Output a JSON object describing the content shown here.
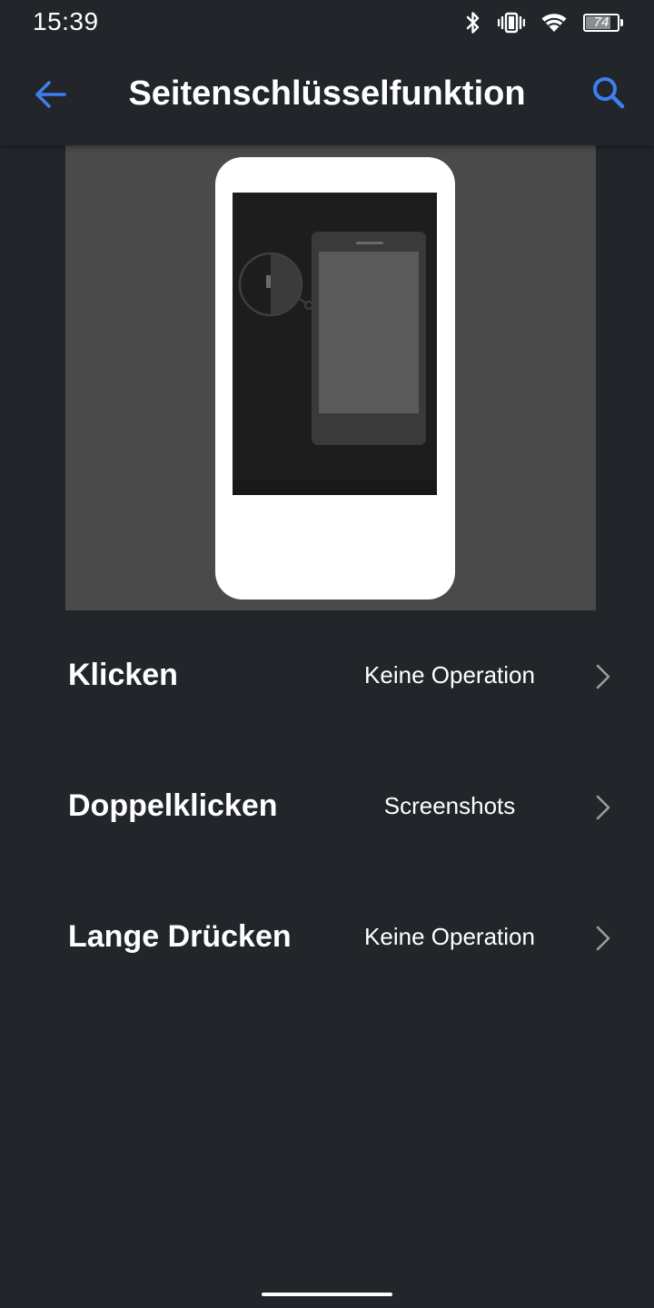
{
  "status_bar": {
    "time": "15:39",
    "battery_level": "74",
    "icons": [
      "bluetooth-icon",
      "vibrate-icon",
      "wifi-icon",
      "battery-icon"
    ]
  },
  "app_bar": {
    "title": "Seitenschlüsselfunktion",
    "back_icon": "arrow-left-icon",
    "search_icon": "search-icon"
  },
  "colors": {
    "background": "#22262b",
    "accent": "#3d7ff0",
    "illustration_bg": "#4a4a4a"
  },
  "options": [
    {
      "label": "Klicken",
      "value": "Keine Operation"
    },
    {
      "label": "Doppelklicken",
      "value": "Screenshots"
    },
    {
      "label": "Lange Drücken",
      "value": "Keine Operation"
    }
  ]
}
